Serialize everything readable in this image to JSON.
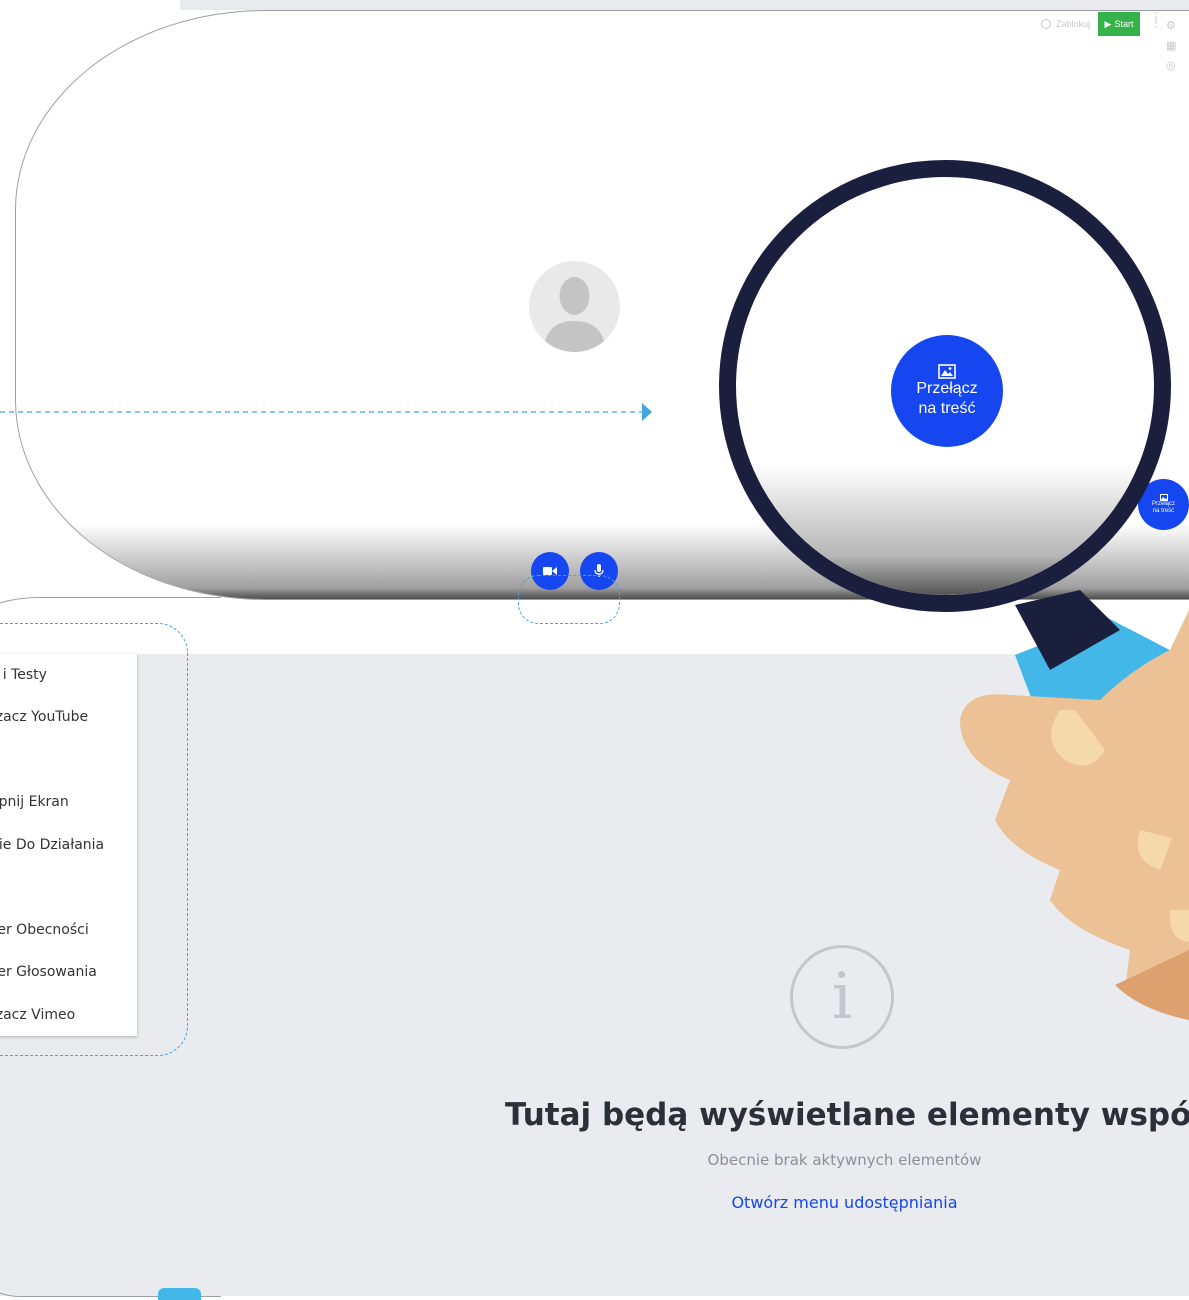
{
  "toolbar": {
    "lock_label": "Zablokuj",
    "start_label": "Start"
  },
  "switch_content": {
    "line1": "Przełącz",
    "line2": "na treść"
  },
  "share_menu": {
    "items": [
      "y i Testy",
      "rzacz YouTube",
      "ępnij Ekran",
      "nie Do Działania",
      "żer Obecności",
      "żer Głosowania",
      "rzacz Vimeo"
    ]
  },
  "empty_state": {
    "title": "Tutaj będą wyświetlane elementy wspólne",
    "subtitle": "Obecnie brak aktywnych elementów",
    "link": "Otwórz menu udostępniania"
  },
  "colors": {
    "accent_blue": "#1546ef",
    "start_green": "#36b24a",
    "dash_blue": "#45a4dc",
    "magnifier_dark": "#1b1f3e",
    "sleeve_blue": "#42b7e8",
    "skin": "#ecc196"
  },
  "icons": {
    "camera": "video-camera-icon",
    "mic": "microphone-icon",
    "image": "image-icon",
    "info": "info-icon",
    "lock": "lock-icon",
    "play": "play-icon"
  }
}
